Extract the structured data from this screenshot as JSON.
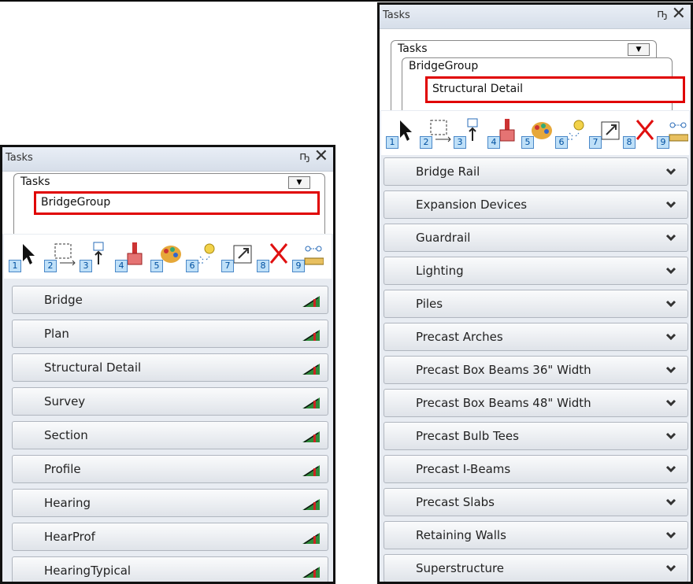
{
  "left_panel": {
    "title": "Tasks",
    "pin_glyph": "Ԅ",
    "close_glyph": "✕",
    "tab_level1": "Tasks",
    "tab_level2": "BridgeGroup",
    "tools": [
      "1",
      "2",
      "3",
      "4",
      "5",
      "6",
      "7",
      "8",
      "9"
    ],
    "items": [
      {
        "label": "Bridge"
      },
      {
        "label": "Plan"
      },
      {
        "label": "Structural Detail"
      },
      {
        "label": "Survey"
      },
      {
        "label": "Section"
      },
      {
        "label": "Profile"
      },
      {
        "label": "Hearing"
      },
      {
        "label": "HearProf"
      },
      {
        "label": "HearingTypical"
      }
    ]
  },
  "right_panel": {
    "title": "Tasks",
    "pin_glyph": "Ԅ",
    "close_glyph": "✕",
    "tab_level1": "Tasks",
    "tab_level2": "BridgeGroup",
    "tab_level3": "Structural Detail",
    "tools": [
      "1",
      "2",
      "3",
      "4",
      "5",
      "6",
      "7",
      "8",
      "9"
    ],
    "items": [
      {
        "label": "Bridge Rail"
      },
      {
        "label": "Expansion Devices"
      },
      {
        "label": "Guardrail"
      },
      {
        "label": "Lighting"
      },
      {
        "label": "Piles"
      },
      {
        "label": "Precast Arches"
      },
      {
        "label": "Precast Box Beams 36\" Width"
      },
      {
        "label": "Precast Box Beams 48\" Width"
      },
      {
        "label": "Precast Bulb Tees"
      },
      {
        "label": "Precast I-Beams"
      },
      {
        "label": "Precast Slabs"
      },
      {
        "label": "Retaining Walls"
      },
      {
        "label": "Superstructure"
      }
    ]
  },
  "colors": {
    "highlight": "#e00000",
    "accent": "#4a88c8"
  }
}
